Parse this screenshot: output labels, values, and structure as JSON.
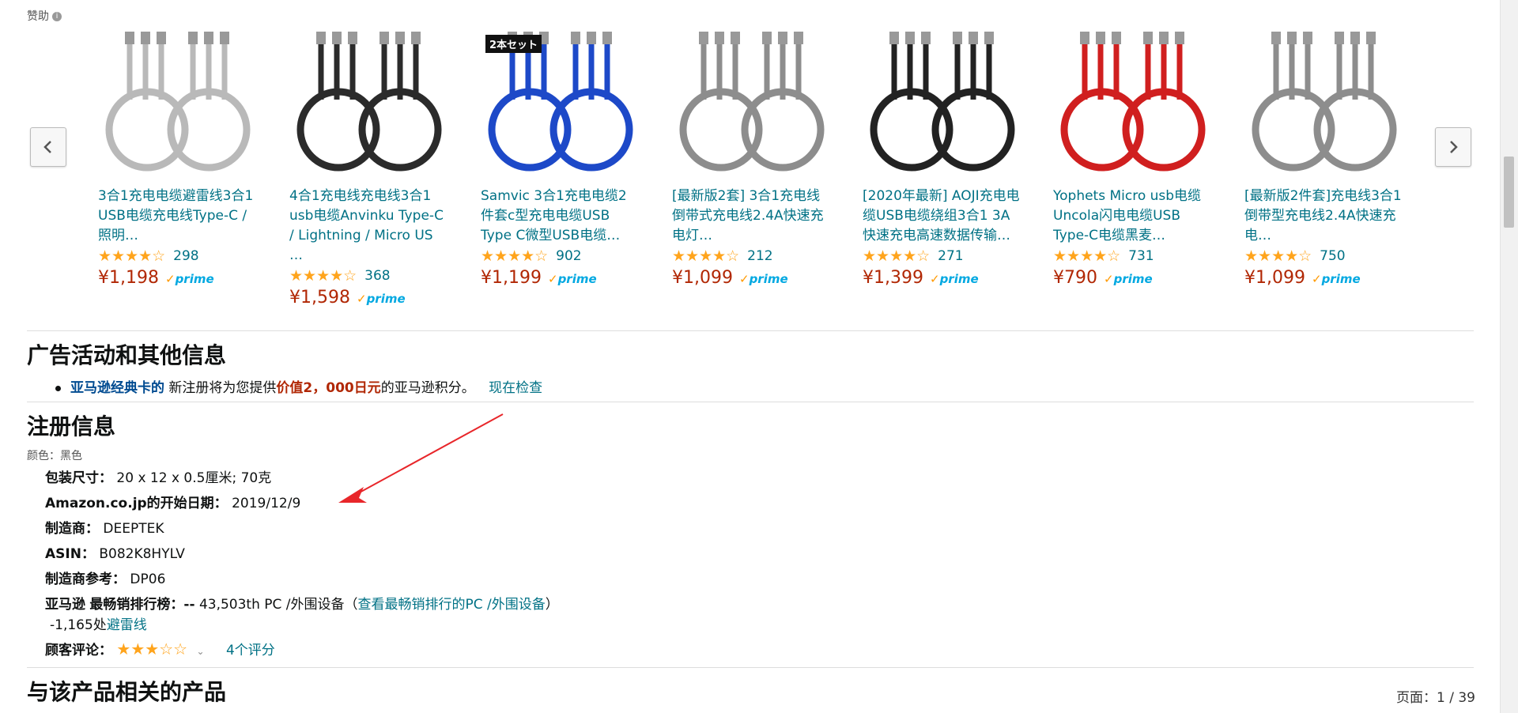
{
  "sponsored": {
    "label": "赞助",
    "info_icon": "i"
  },
  "carousel": {
    "prev_icon": "chevron-left-icon",
    "next_icon": "chevron-right-icon",
    "products": [
      {
        "title": "3合1充电电缆避雷线3合1 USB电缆充电线Type-C /照明…",
        "stars": "★★★★☆",
        "rating_count": "298",
        "price": "¥1,198",
        "prime": "prime",
        "cable_color": "#b9b9b9",
        "badge": ""
      },
      {
        "title": "4合1充电线充电线3合1 usb电缆Anvinku Type-C / Lightning / Micro US …",
        "stars": "★★★★☆",
        "rating_count": "368",
        "price": "¥1,598",
        "prime": "prime",
        "cable_color": "#2b2b2b",
        "badge": ""
      },
      {
        "title": "Samvic 3合1充电电缆2件套c型充电电缆USB Type C微型USB电缆…",
        "stars": "★★★★☆",
        "rating_count": "902",
        "price": "¥1,199",
        "prime": "prime",
        "cable_color": "#1d49c8",
        "badge": "2本セット"
      },
      {
        "title": "[最新版2套] 3合1充电线 倒带式充电线2.4A快速充电灯…",
        "stars": "★★★★☆",
        "rating_count": "212",
        "price": "¥1,099",
        "prime": "prime",
        "cable_color": "#8d8d8d",
        "badge": ""
      },
      {
        "title": "[2020年最新] AOJI充电电缆USB电缆绕组3合1 3A快速充电高速数据传输…",
        "stars": "★★★★☆",
        "rating_count": "271",
        "price": "¥1,399",
        "prime": "prime",
        "cable_color": "#222222",
        "badge": ""
      },
      {
        "title": "Yophets Micro usb电缆 Uncola闪电电缆USB Type-C电缆黑麦…",
        "stars": "★★★★☆",
        "rating_count": "731",
        "price": "¥790",
        "prime": "prime",
        "cable_color": "#d01f1f",
        "badge": ""
      },
      {
        "title": "[最新版2件套]充电线3合1倒带型充电线2.4A快速充电…",
        "stars": "★★★★☆",
        "rating_count": "750",
        "price": "¥1,099",
        "prime": "prime",
        "cable_color": "#8d8d8d",
        "badge": ""
      }
    ]
  },
  "promotions": {
    "heading": "广告活动和其他信息",
    "item": {
      "card_name": "亚马逊经典卡的",
      "text1": "新注册将为您提供",
      "highlight": "价值2，000日元",
      "text2": "的亚马逊积分。",
      "link": "现在检查"
    }
  },
  "registration": {
    "heading": "注册信息",
    "color_label": "颜色：黑色",
    "package_label": "包装尺寸：",
    "package_value": "20 x 12 x 0.5厘米; 70克",
    "date_label": "Amazon.co.jp的开始日期：",
    "date_value": "2019/12/9",
    "maker_label": "制造商：",
    "maker_value": "DEEPTEK",
    "asin_label": "ASIN：",
    "asin_value": "B082K8HYLV",
    "ref_label": "制造商参考：",
    "ref_value": "DP06",
    "rank_label_a": "亚马逊",
    "rank_label_b": "最畅销排行榜：--",
    "rank_value": "43,503th PC /外围设备（",
    "rank_link": "查看最畅销排行的PC /外围设备",
    "rank_close": "）",
    "sub_rank_num": "-1,165处",
    "sub_rank_link": "避雷线",
    "review_label": "顾客评论：",
    "review_stars": "★★★☆☆",
    "review_count": "4个评分"
  },
  "related": {
    "heading": "与该产品相关的产品",
    "page_indicator": "页面：1 / 39"
  },
  "colors": {
    "link": "#007185",
    "price": "#b12704",
    "star": "#ffa41c",
    "annotation_arrow": "#e8262a"
  }
}
